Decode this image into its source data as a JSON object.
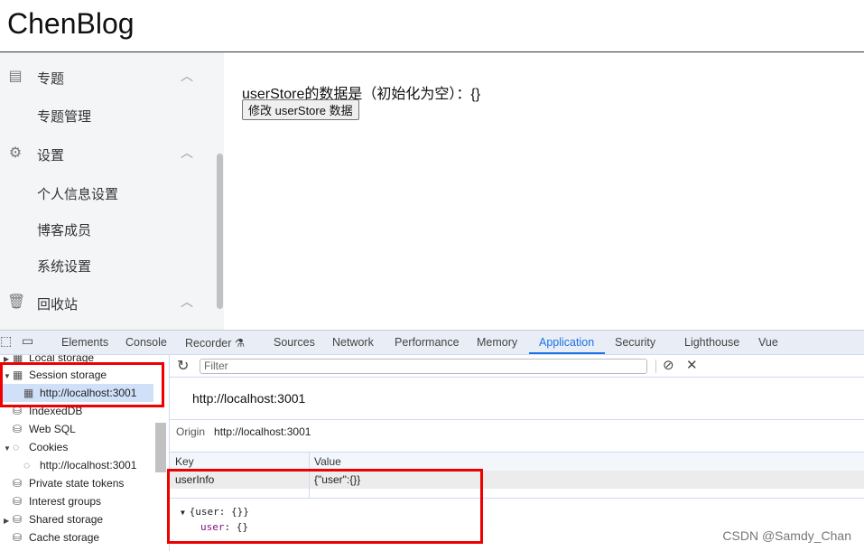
{
  "header": {
    "logo": "ChenBlog"
  },
  "sidebar": {
    "items": [
      {
        "label": "专题",
        "icon": "document-icon",
        "chevron": "︿"
      },
      {
        "label": "专题管理"
      },
      {
        "label": "设置",
        "icon": "gear-icon",
        "chevron": "︿"
      },
      {
        "label": "个人信息设置"
      },
      {
        "label": "博客成员"
      },
      {
        "label": "系统设置"
      },
      {
        "label": "回收站",
        "icon": "trash-icon",
        "chevron": "︿"
      }
    ]
  },
  "main": {
    "text": "userStore的数据是（初始化为空）：{}",
    "button": "修改 userStore 数据"
  },
  "devtools": {
    "tabs": [
      "Elements",
      "Console",
      "Recorder ⚗",
      "Sources",
      "Network",
      "Performance",
      "Memory",
      "Application",
      "Security",
      "Lighthouse",
      "Vue"
    ],
    "active_tab": "Application",
    "tree": [
      "Local storage",
      "Session storage",
      "http://localhost:3001",
      "IndexedDB",
      "Web SQL",
      "Cookies",
      "http://localhost:3001",
      "Private state tokens",
      "Interest groups",
      "Shared storage",
      "Cache storage"
    ],
    "filter_placeholder": "Filter",
    "origin_title": "http://localhost:3001",
    "origin_label": "Origin",
    "origin_value": "http://localhost:3001",
    "columns": [
      "Key",
      "Value"
    ],
    "rows": [
      {
        "key": "userInfo",
        "value": "{\"user\":{}}"
      }
    ],
    "preview_root": "{user: {}}",
    "preview_key": "user",
    "preview_val": ": {}",
    "accent": "#1a73e8",
    "highlight": "#ee0000"
  },
  "watermark": "CSDN @Samdy_Chan"
}
